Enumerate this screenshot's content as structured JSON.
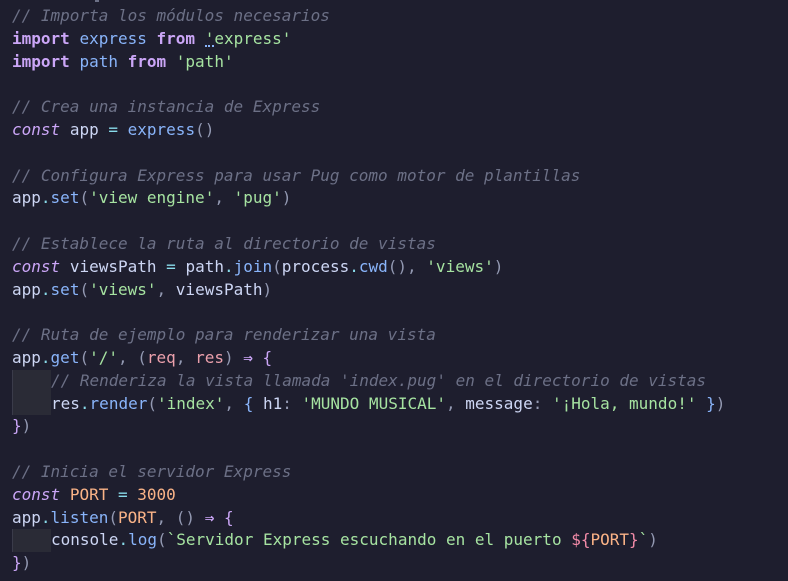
{
  "editor": {
    "theme_colors": {
      "background": "#1e1e2e",
      "comment": "#6c7086",
      "keyword": "#cba6f7",
      "identifier": "#89b4fa",
      "string": "#a6e3a1",
      "number": "#fab387",
      "parameter": "#eba0ac",
      "operator": "#89dceb",
      "text": "#cdd6f4"
    },
    "lines": [
      {
        "indent": 0,
        "tokens": [
          {
            "t": "// Importa los módulos necesarios",
            "c": "t-comment"
          }
        ]
      },
      {
        "indent": 0,
        "tokens": [
          {
            "t": "import",
            "c": "t-keyword"
          },
          {
            "t": " ",
            "c": "t-text"
          },
          {
            "t": "express",
            "c": "t-ident"
          },
          {
            "t": " ",
            "c": "t-text"
          },
          {
            "t": "from",
            "c": "t-keyword"
          },
          {
            "t": " ",
            "c": "t-text"
          },
          {
            "t": "'",
            "c": "t-str squiggle-char"
          },
          {
            "t": "express'",
            "c": "t-str"
          }
        ]
      },
      {
        "indent": 0,
        "tokens": [
          {
            "t": "import",
            "c": "t-keyword"
          },
          {
            "t": " ",
            "c": "t-text"
          },
          {
            "t": "path",
            "c": "t-ident"
          },
          {
            "t": " ",
            "c": "t-text"
          },
          {
            "t": "from",
            "c": "t-keyword"
          },
          {
            "t": " ",
            "c": "t-text"
          },
          {
            "t": "'path'",
            "c": "t-str"
          }
        ]
      },
      {
        "indent": 0,
        "tokens": []
      },
      {
        "indent": 0,
        "tokens": [
          {
            "t": "// Crea una instancia de Express",
            "c": "t-comment"
          }
        ]
      },
      {
        "indent": 0,
        "tokens": [
          {
            "t": "const",
            "c": "t-storage"
          },
          {
            "t": " ",
            "c": "t-text"
          },
          {
            "t": "app",
            "c": "t-var"
          },
          {
            "t": " ",
            "c": "t-text"
          },
          {
            "t": "=",
            "c": "t-op"
          },
          {
            "t": " ",
            "c": "t-text"
          },
          {
            "t": "express",
            "c": "t-fn"
          },
          {
            "t": "()",
            "c": "t-punct"
          }
        ]
      },
      {
        "indent": 0,
        "tokens": []
      },
      {
        "indent": 0,
        "tokens": [
          {
            "t": "// Configura Express para usar Pug como motor de plantillas",
            "c": "t-comment"
          }
        ]
      },
      {
        "indent": 0,
        "tokens": [
          {
            "t": "app",
            "c": "t-var"
          },
          {
            "t": ".",
            "c": "t-op"
          },
          {
            "t": "set",
            "c": "t-fn"
          },
          {
            "t": "(",
            "c": "t-punct"
          },
          {
            "t": "'view engine'",
            "c": "t-str"
          },
          {
            "t": ", ",
            "c": "t-punct"
          },
          {
            "t": "'pug'",
            "c": "t-str"
          },
          {
            "t": ")",
            "c": "t-punct"
          }
        ]
      },
      {
        "indent": 0,
        "tokens": []
      },
      {
        "indent": 0,
        "tokens": [
          {
            "t": "// Establece la ruta al directorio de vistas",
            "c": "t-comment"
          }
        ]
      },
      {
        "indent": 0,
        "tokens": [
          {
            "t": "const",
            "c": "t-storage"
          },
          {
            "t": " ",
            "c": "t-text"
          },
          {
            "t": "viewsPath",
            "c": "t-var"
          },
          {
            "t": " ",
            "c": "t-text"
          },
          {
            "t": "=",
            "c": "t-op"
          },
          {
            "t": " ",
            "c": "t-text"
          },
          {
            "t": "path",
            "c": "t-var"
          },
          {
            "t": ".",
            "c": "t-op"
          },
          {
            "t": "join",
            "c": "t-fn"
          },
          {
            "t": "(",
            "c": "t-punct"
          },
          {
            "t": "process",
            "c": "t-var"
          },
          {
            "t": ".",
            "c": "t-op"
          },
          {
            "t": "cwd",
            "c": "t-fn"
          },
          {
            "t": "(), ",
            "c": "t-punct"
          },
          {
            "t": "'views'",
            "c": "t-str"
          },
          {
            "t": ")",
            "c": "t-punct"
          }
        ]
      },
      {
        "indent": 0,
        "tokens": [
          {
            "t": "app",
            "c": "t-var"
          },
          {
            "t": ".",
            "c": "t-op"
          },
          {
            "t": "set",
            "c": "t-fn"
          },
          {
            "t": "(",
            "c": "t-punct"
          },
          {
            "t": "'views'",
            "c": "t-str"
          },
          {
            "t": ", ",
            "c": "t-punct"
          },
          {
            "t": "viewsPath",
            "c": "t-var"
          },
          {
            "t": ")",
            "c": "t-punct"
          }
        ]
      },
      {
        "indent": 0,
        "tokens": []
      },
      {
        "indent": 0,
        "tokens": [
          {
            "t": "// Ruta de ejemplo para renderizar una vista",
            "c": "t-comment"
          }
        ]
      },
      {
        "indent": 0,
        "tokens": [
          {
            "t": "app",
            "c": "t-var"
          },
          {
            "t": ".",
            "c": "t-op"
          },
          {
            "t": "get",
            "c": "t-fn"
          },
          {
            "t": "(",
            "c": "t-punct"
          },
          {
            "t": "'/'",
            "c": "t-str"
          },
          {
            "t": ", ",
            "c": "t-punct"
          },
          {
            "t": "(",
            "c": "t-punct"
          },
          {
            "t": "req",
            "c": "t-param"
          },
          {
            "t": ", ",
            "c": "t-punct"
          },
          {
            "t": "res",
            "c": "t-param"
          },
          {
            "t": ")",
            "c": "t-punct"
          },
          {
            "t": " ",
            "c": "t-text"
          },
          {
            "t": "⇒",
            "c": "t-keyword"
          },
          {
            "t": " ",
            "c": "t-text"
          },
          {
            "t": "{",
            "c": "t-brace1"
          }
        ]
      },
      {
        "indent": 1,
        "tokens": [
          {
            "t": "// Renderiza la vista llamada 'index.pug' en el directorio de vistas",
            "c": "t-comment"
          }
        ]
      },
      {
        "indent": 1,
        "tokens": [
          {
            "t": "res",
            "c": "t-var"
          },
          {
            "t": ".",
            "c": "t-op"
          },
          {
            "t": "render",
            "c": "t-fn"
          },
          {
            "t": "(",
            "c": "t-punct"
          },
          {
            "t": "'index'",
            "c": "t-str"
          },
          {
            "t": ", ",
            "c": "t-punct"
          },
          {
            "t": "{",
            "c": "t-brace2"
          },
          {
            "t": " h1",
            "c": "t-var"
          },
          {
            "t": ": ",
            "c": "t-punct"
          },
          {
            "t": "'MUNDO MUSICAL'",
            "c": "t-str"
          },
          {
            "t": ", ",
            "c": "t-punct"
          },
          {
            "t": "message",
            "c": "t-var"
          },
          {
            "t": ": ",
            "c": "t-punct"
          },
          {
            "t": "'¡Hola, mundo!'",
            "c": "t-str"
          },
          {
            "t": " ",
            "c": "t-text"
          },
          {
            "t": "}",
            "c": "t-brace2"
          },
          {
            "t": ")",
            "c": "t-punct"
          }
        ]
      },
      {
        "indent": 0,
        "tokens": [
          {
            "t": "}",
            "c": "t-brace1"
          },
          {
            "t": ")",
            "c": "t-punct"
          }
        ]
      },
      {
        "indent": 0,
        "tokens": []
      },
      {
        "indent": 0,
        "tokens": [
          {
            "t": "// Inicia el servidor Express",
            "c": "t-comment"
          }
        ]
      },
      {
        "indent": 0,
        "tokens": [
          {
            "t": "const",
            "c": "t-storage"
          },
          {
            "t": " ",
            "c": "t-text"
          },
          {
            "t": "PORT",
            "c": "t-const"
          },
          {
            "t": " ",
            "c": "t-text"
          },
          {
            "t": "=",
            "c": "t-op"
          },
          {
            "t": " ",
            "c": "t-text"
          },
          {
            "t": "3000",
            "c": "t-num"
          }
        ]
      },
      {
        "indent": 0,
        "tokens": [
          {
            "t": "app",
            "c": "t-var"
          },
          {
            "t": ".",
            "c": "t-op"
          },
          {
            "t": "listen",
            "c": "t-fn"
          },
          {
            "t": "(",
            "c": "t-punct"
          },
          {
            "t": "PORT",
            "c": "t-const"
          },
          {
            "t": ", ",
            "c": "t-punct"
          },
          {
            "t": "()",
            "c": "t-punct"
          },
          {
            "t": " ",
            "c": "t-text"
          },
          {
            "t": "⇒",
            "c": "t-keyword"
          },
          {
            "t": " ",
            "c": "t-text"
          },
          {
            "t": "{",
            "c": "t-brace1"
          }
        ]
      },
      {
        "indent": 1,
        "tokens": [
          {
            "t": "console",
            "c": "t-var"
          },
          {
            "t": ".",
            "c": "t-op"
          },
          {
            "t": "log",
            "c": "t-fn"
          },
          {
            "t": "(",
            "c": "t-punct"
          },
          {
            "t": "`Servidor Express escuchando en el puerto ",
            "c": "t-str"
          },
          {
            "t": "${",
            "c": "t-interp"
          },
          {
            "t": "PORT",
            "c": "t-const"
          },
          {
            "t": "}",
            "c": "t-interp"
          },
          {
            "t": "`",
            "c": "t-str"
          },
          {
            "t": ")",
            "c": "t-punct"
          }
        ]
      },
      {
        "indent": 0,
        "tokens": [
          {
            "t": "}",
            "c": "t-brace1"
          },
          {
            "t": ")",
            "c": "t-punct"
          }
        ]
      }
    ]
  }
}
